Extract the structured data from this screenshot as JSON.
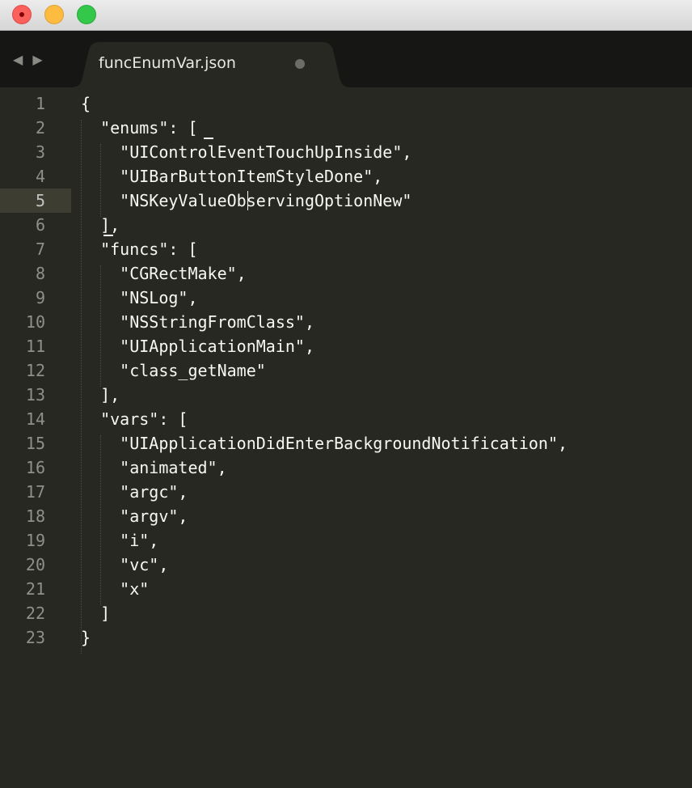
{
  "window": {
    "buttons": [
      "close",
      "minimize",
      "zoom"
    ]
  },
  "tabbar": {
    "back_glyph": "◀",
    "forward_glyph": "▶",
    "tab": {
      "title": "funcEnumVar.json",
      "modified": true
    }
  },
  "editor": {
    "active_line": 5,
    "line_numbers": [
      "1",
      "2",
      "3",
      "4",
      "5",
      "6",
      "7",
      "8",
      "9",
      "10",
      "11",
      "12",
      "13",
      "14",
      "15",
      "16",
      "17",
      "18",
      "19",
      "20",
      "21",
      "22",
      "23"
    ],
    "lines": [
      "{",
      "  \"enums\": [",
      "    \"UIControlEventTouchUpInside\",",
      "    \"UIBarButtonItemStyleDone\",",
      "    \"NSKeyValueObservingOptionNew\"",
      "  ],",
      "  \"funcs\": [",
      "    \"CGRectMake\",",
      "    \"NSLog\",",
      "    \"NSStringFromClass\",",
      "    \"UIApplicationMain\",",
      "    \"class_getName\"",
      "  ],",
      "  \"vars\": [",
      "    \"UIApplicationDidEnterBackgroundNotification\",",
      "    \"animated\",",
      "    \"argc\",",
      "    \"argv\",",
      "    \"i\",",
      "    \"vc\",",
      "    \"x\"",
      "  ]",
      "}"
    ]
  },
  "colors": {
    "editor_bg": "#272822",
    "text": "#f8f8f2",
    "gutter_text": "#8f908a",
    "active_line_bg": "#3e3d32",
    "tabbar_bg": "#161714"
  }
}
